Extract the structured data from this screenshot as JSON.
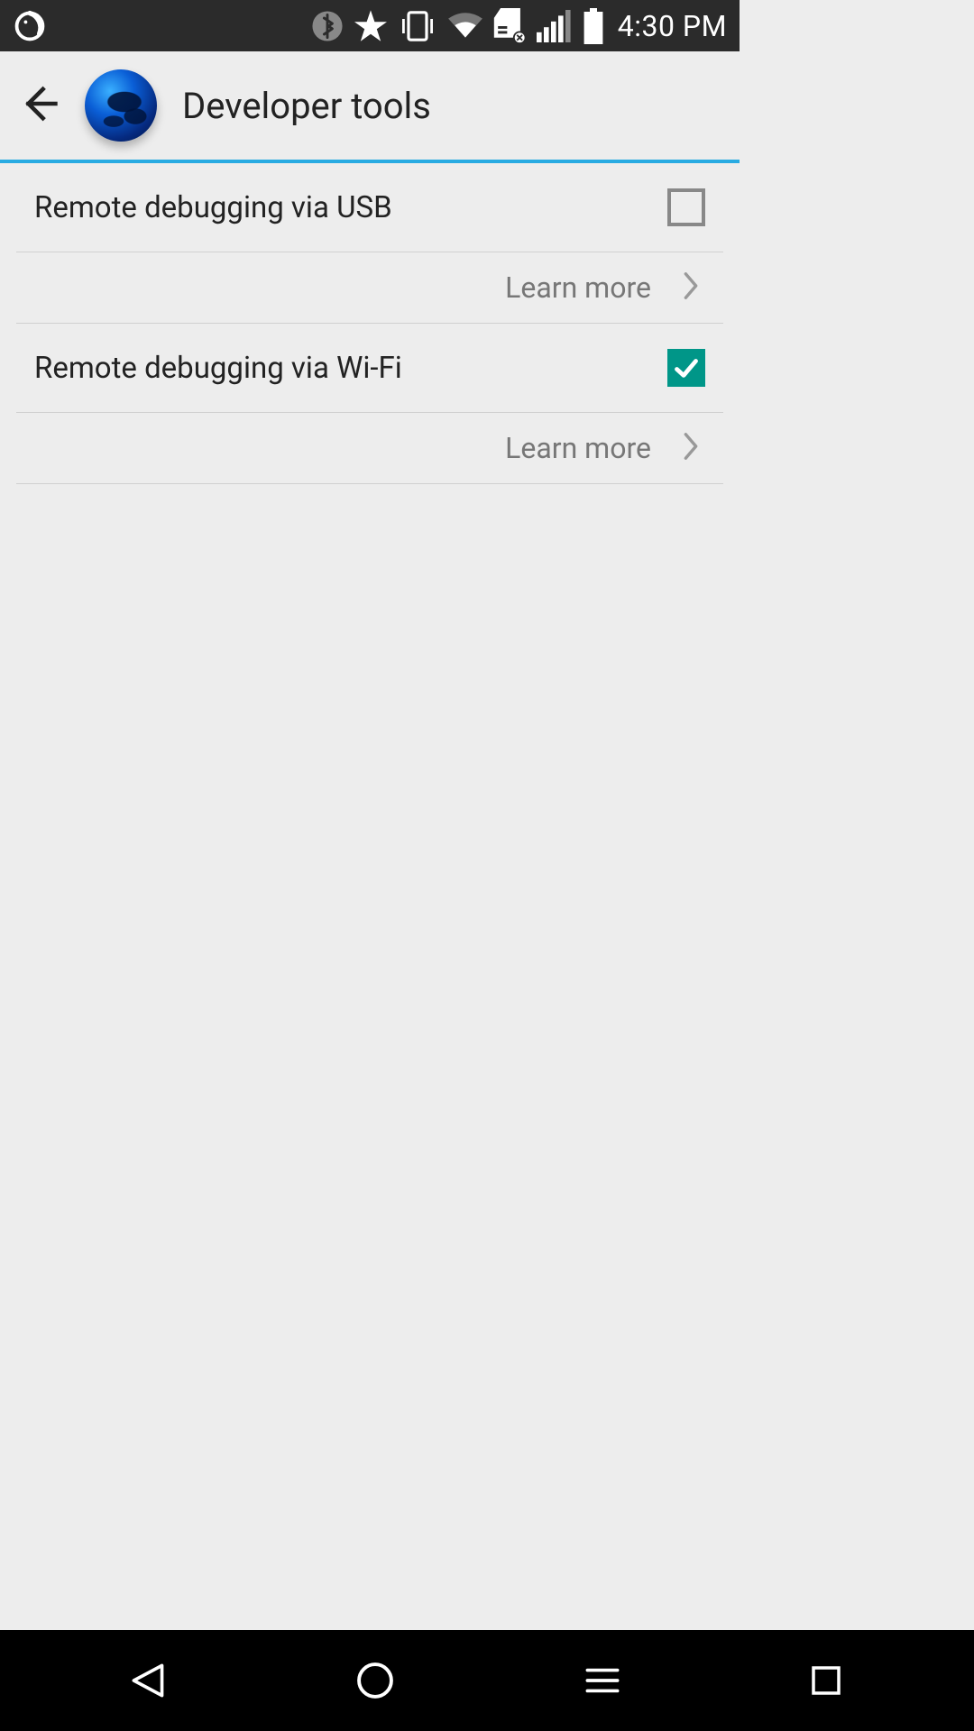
{
  "status_bar": {
    "time": "4:30 PM"
  },
  "header": {
    "title": "Developer tools"
  },
  "settings": [
    {
      "label": "Remote debugging via USB",
      "checked": false,
      "learn_more": "Learn more"
    },
    {
      "label": "Remote debugging via Wi-Fi",
      "checked": true,
      "learn_more": "Learn more"
    }
  ]
}
